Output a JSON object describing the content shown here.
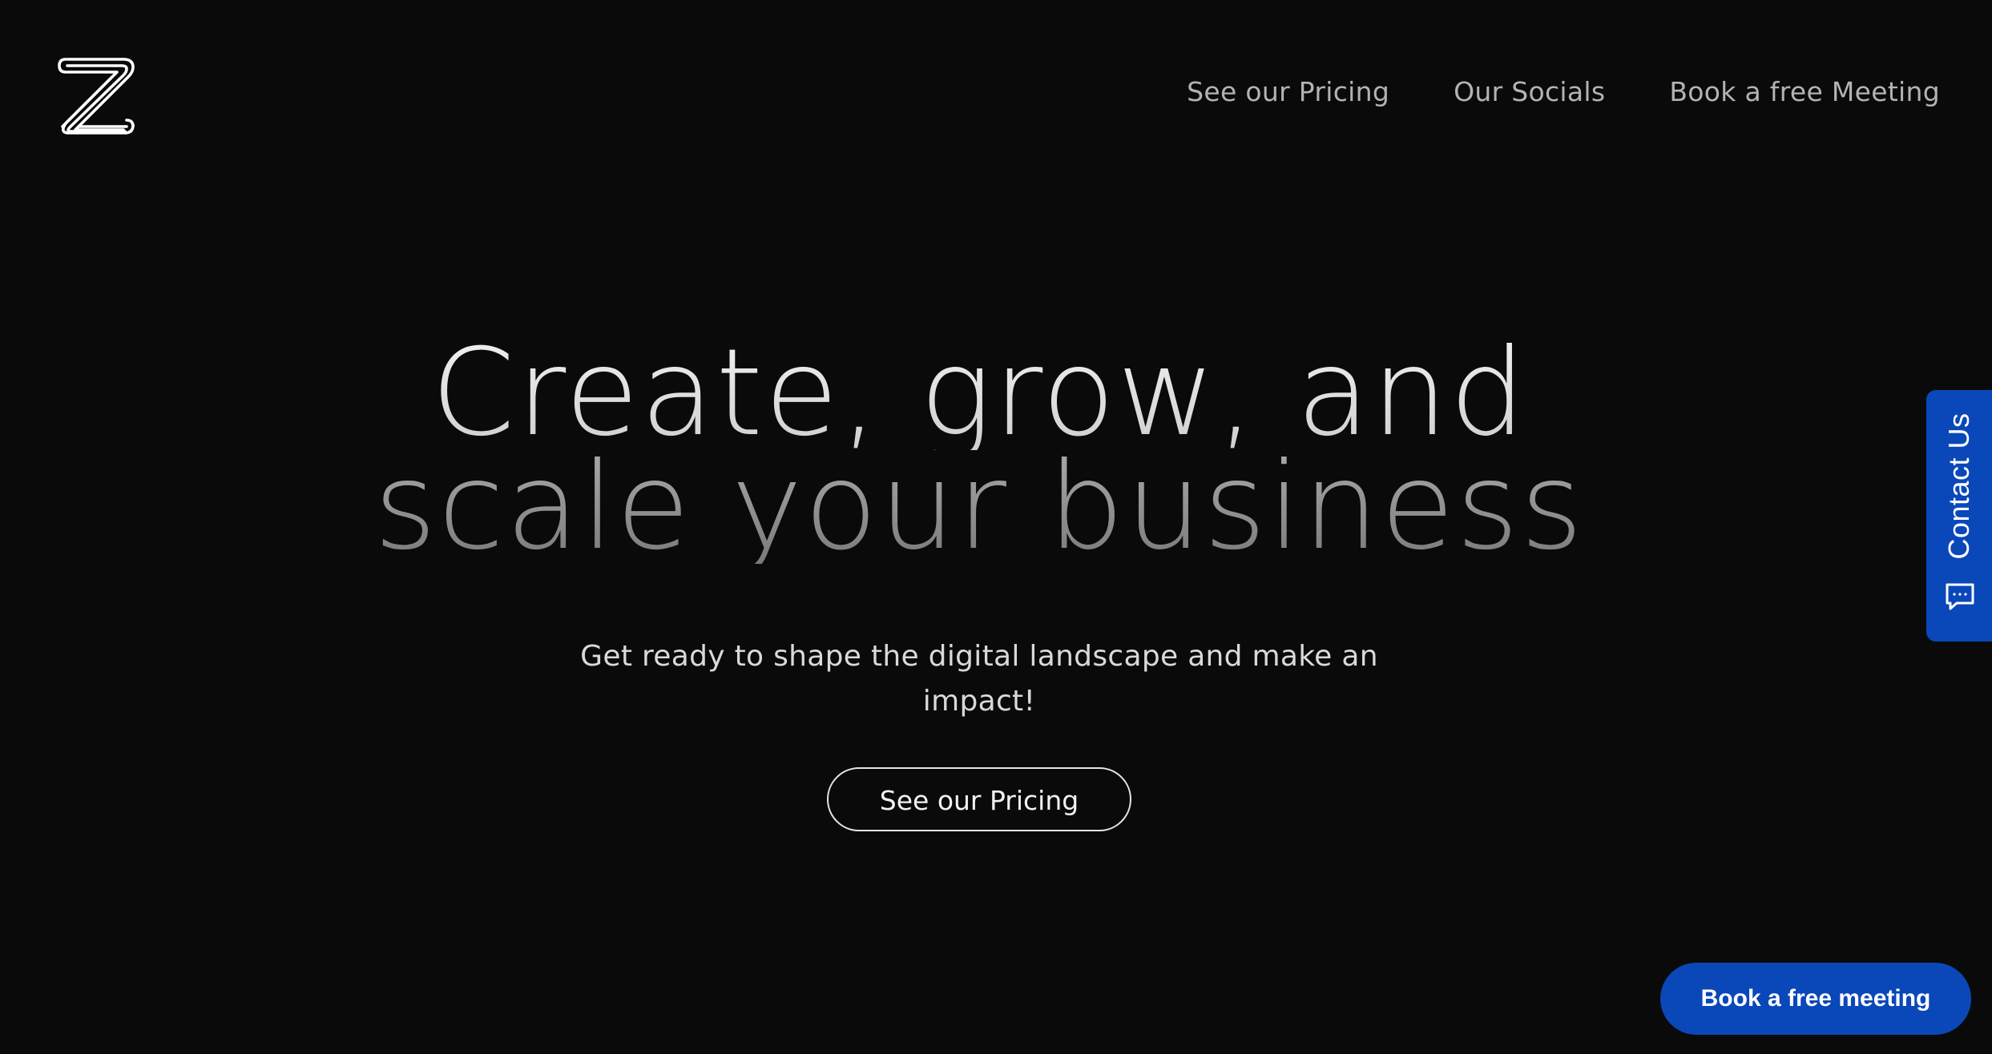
{
  "header": {
    "logo_icon": "z-stripes-logo-icon",
    "nav": [
      {
        "label": "See our Pricing"
      },
      {
        "label": "Our Socials"
      },
      {
        "label": "Book a free Meeting"
      }
    ]
  },
  "hero": {
    "headline_line1": "Create, grow, and",
    "headline_line2": "scale your business",
    "subtitle": "Get ready to shape the digital landscape and make an impact!",
    "cta_label": "See our Pricing"
  },
  "contact_tab": {
    "label": "Contact Us",
    "icon": "chat-bubble-icon"
  },
  "floating_button": {
    "label": "Book a free meeting"
  },
  "colors": {
    "background": "#0a0a0a",
    "accent_blue": "#0a47b9",
    "nav_text": "#b3b3b3"
  }
}
